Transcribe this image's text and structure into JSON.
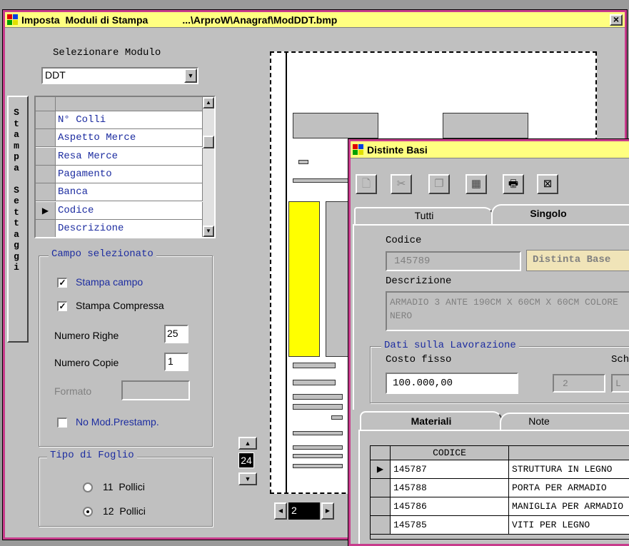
{
  "main": {
    "title": "Imposta  Moduli di Stampa",
    "path": "...\\ArproW\\Anagraf\\ModDDT.bmp",
    "close": "×",
    "select_label": "Selezionare Modulo",
    "module_value": "DDT",
    "side_button": [
      "S",
      "t",
      "a",
      "m",
      "p",
      "a",
      "",
      "S",
      "e",
      "t",
      "t",
      "a",
      "g",
      "g",
      "i"
    ],
    "fields": [
      "N° Colli",
      "Aspetto Merce",
      "Resa Merce",
      "Pagamento",
      "Banca",
      "Codice",
      "Descrizione"
    ],
    "selected_row_marker": "▶",
    "campo_legend": "Campo selezionato",
    "stampa_campo": "Stampa campo",
    "stampa_compressa": "Stampa Compressa",
    "numero_righe_label": "Numero Righe",
    "numero_righe": "25",
    "numero_copie_label": "Numero Copie",
    "numero_copie": "1",
    "formato_label": "Formato",
    "formato_value": "",
    "no_mod": "No Mod.Prestamp.",
    "foglio_legend": "Tipo di Foglio",
    "opt11": "11  Pollici",
    "opt12": "12  Pollici",
    "spin_value": "24",
    "page_value": "2",
    "up": "▲",
    "down": "▼",
    "left": "◀",
    "right": "▶"
  },
  "distinte": {
    "title": "Distinte Basi",
    "tab_tutti": "Tutti",
    "tab_singolo": "Singolo",
    "codice_label": "Codice",
    "codice": "145789",
    "badge": "Distinta Base",
    "descr_label": "Descrizione",
    "descr": "ARMADIO 3 ANTE 190CM X 60CM X 60CM COLORE NERO",
    "dati_legend": "Dati sulla Lavorazione",
    "costo_label": "Costo fisso",
    "costo": "100.000,00",
    "sch_label": "Sch",
    "field2": "2",
    "fieldL": "L",
    "tab_materiali": "Materiali",
    "tab_note": "Note",
    "col_codice": "CODICE",
    "rows": [
      {
        "code": "145787",
        "desc": "STRUTTURA IN LEGNO"
      },
      {
        "code": "145788",
        "desc": "PORTA PER ARMADIO"
      },
      {
        "code": "145786",
        "desc": "MANIGLIA PER ARMADIO"
      },
      {
        "code": "145785",
        "desc": "VITI PER LEGNO"
      }
    ]
  },
  "colors": {
    "titlebar": "#ffff80",
    "frame": "#c83c8c",
    "face": "#c0c0c0",
    "link": "#1c2ca0",
    "preview_yellow": "#ffff00"
  },
  "icons": {
    "app": "app-icon",
    "close": "close-icon",
    "new": "new-doc-icon",
    "cut": "cut-icon",
    "copy": "copy-icon",
    "calc": "calculator-icon",
    "print": "print-icon",
    "exit": "exit-icon"
  }
}
